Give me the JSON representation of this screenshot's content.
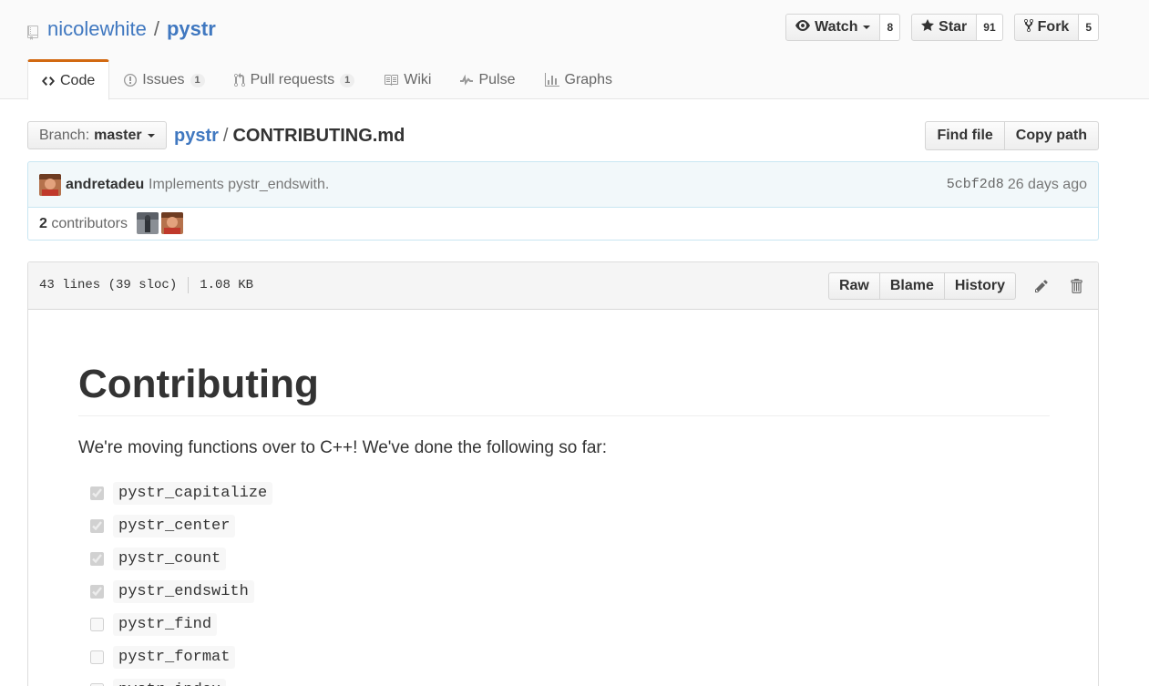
{
  "repo": {
    "owner": "nicolewhite",
    "name": "pystr",
    "separator": "/"
  },
  "actions": [
    {
      "label": "Watch",
      "count": "8",
      "icon": "eye-icon"
    },
    {
      "label": "Star",
      "count": "91",
      "icon": "star-icon"
    },
    {
      "label": "Fork",
      "count": "5",
      "icon": "fork-icon"
    }
  ],
  "nav": [
    {
      "label": "Code",
      "icon": "code-icon",
      "counter": ""
    },
    {
      "label": "Issues",
      "icon": "issue-icon",
      "counter": "1"
    },
    {
      "label": "Pull requests",
      "icon": "pull-request-icon",
      "counter": "1"
    },
    {
      "label": "Wiki",
      "icon": "book-icon",
      "counter": ""
    },
    {
      "label": "Pulse",
      "icon": "pulse-icon",
      "counter": ""
    },
    {
      "label": "Graphs",
      "icon": "graph-icon",
      "counter": ""
    }
  ],
  "branch": {
    "label": "Branch:",
    "value": "master"
  },
  "breadcrumb": {
    "root": "pystr",
    "separator": "/",
    "file": "CONTRIBUTING.md"
  },
  "file_nav": {
    "find_file": "Find file",
    "copy_path": "Copy path"
  },
  "commit": {
    "author": "andretadeu",
    "message": "Implements pystr_endswith.",
    "sha": "5cbf2d8",
    "age": "26 days ago"
  },
  "contributors": {
    "count": "2",
    "label": "contributors"
  },
  "file_info": {
    "lines": "43 lines (39 sloc)",
    "size": "1.08 KB"
  },
  "file_actions": {
    "raw": "Raw",
    "blame": "Blame",
    "history": "History"
  },
  "content": {
    "heading": "Contributing",
    "intro": "We're moving functions over to C++! We've done the following so far:",
    "tasks": [
      {
        "name": "pystr_capitalize",
        "done": true
      },
      {
        "name": "pystr_center",
        "done": true
      },
      {
        "name": "pystr_count",
        "done": true
      },
      {
        "name": "pystr_endswith",
        "done": true
      },
      {
        "name": "pystr_find",
        "done": false
      },
      {
        "name": "pystr_format",
        "done": false
      },
      {
        "name": "pystr_index",
        "done": false
      }
    ]
  },
  "colors": {
    "link": "#4078c0",
    "nav_accent": "#d26911",
    "commit_bg": "#f2f8fa"
  }
}
